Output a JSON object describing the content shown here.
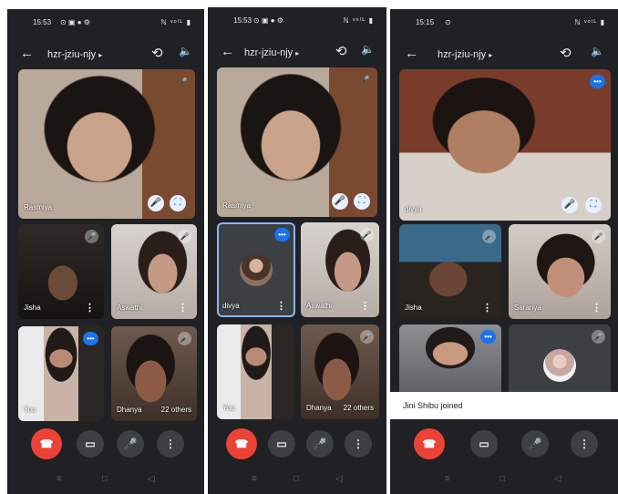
{
  "statusbar": {
    "p1_time": "15:53",
    "p2_time": "15:53",
    "p3_time": "15:15",
    "p1_icons": "⊙ ▣ ● ⚙",
    "p2_icons": "⊙ ▣ ● ⚙",
    "p3_icons": "⊙",
    "sys": "ℕ ᵛᵒ⁽ᴸ ▮"
  },
  "meeting": {
    "code": "hzr-jziu-njy",
    "caret": "▸"
  },
  "icons": {
    "back": "←",
    "flip": "⟲",
    "speaker": "🔈",
    "mic_off": "🎤",
    "speaking": "•••",
    "mic": "🎤",
    "fullscreen": "⛶",
    "more": "⋮",
    "end": "☎",
    "camera": "▭"
  },
  "participants": {
    "main_p1": "Rasmiya",
    "main_p2": "Rasmiya",
    "main_p3": "divya",
    "jisha": "Jisha",
    "aswathi": "Aswathi",
    "you": "You",
    "dhanya": "Dhanya",
    "divya": "divya",
    "saranya": "Saranya",
    "others": "22 others"
  },
  "toast": "Jini Shibu joined",
  "nav": {
    "recent": "≡",
    "home": "□",
    "back": "◁"
  },
  "colors": {
    "end_call": "#ea4335",
    "accent": "#1a73e8",
    "bg": "#202124"
  }
}
